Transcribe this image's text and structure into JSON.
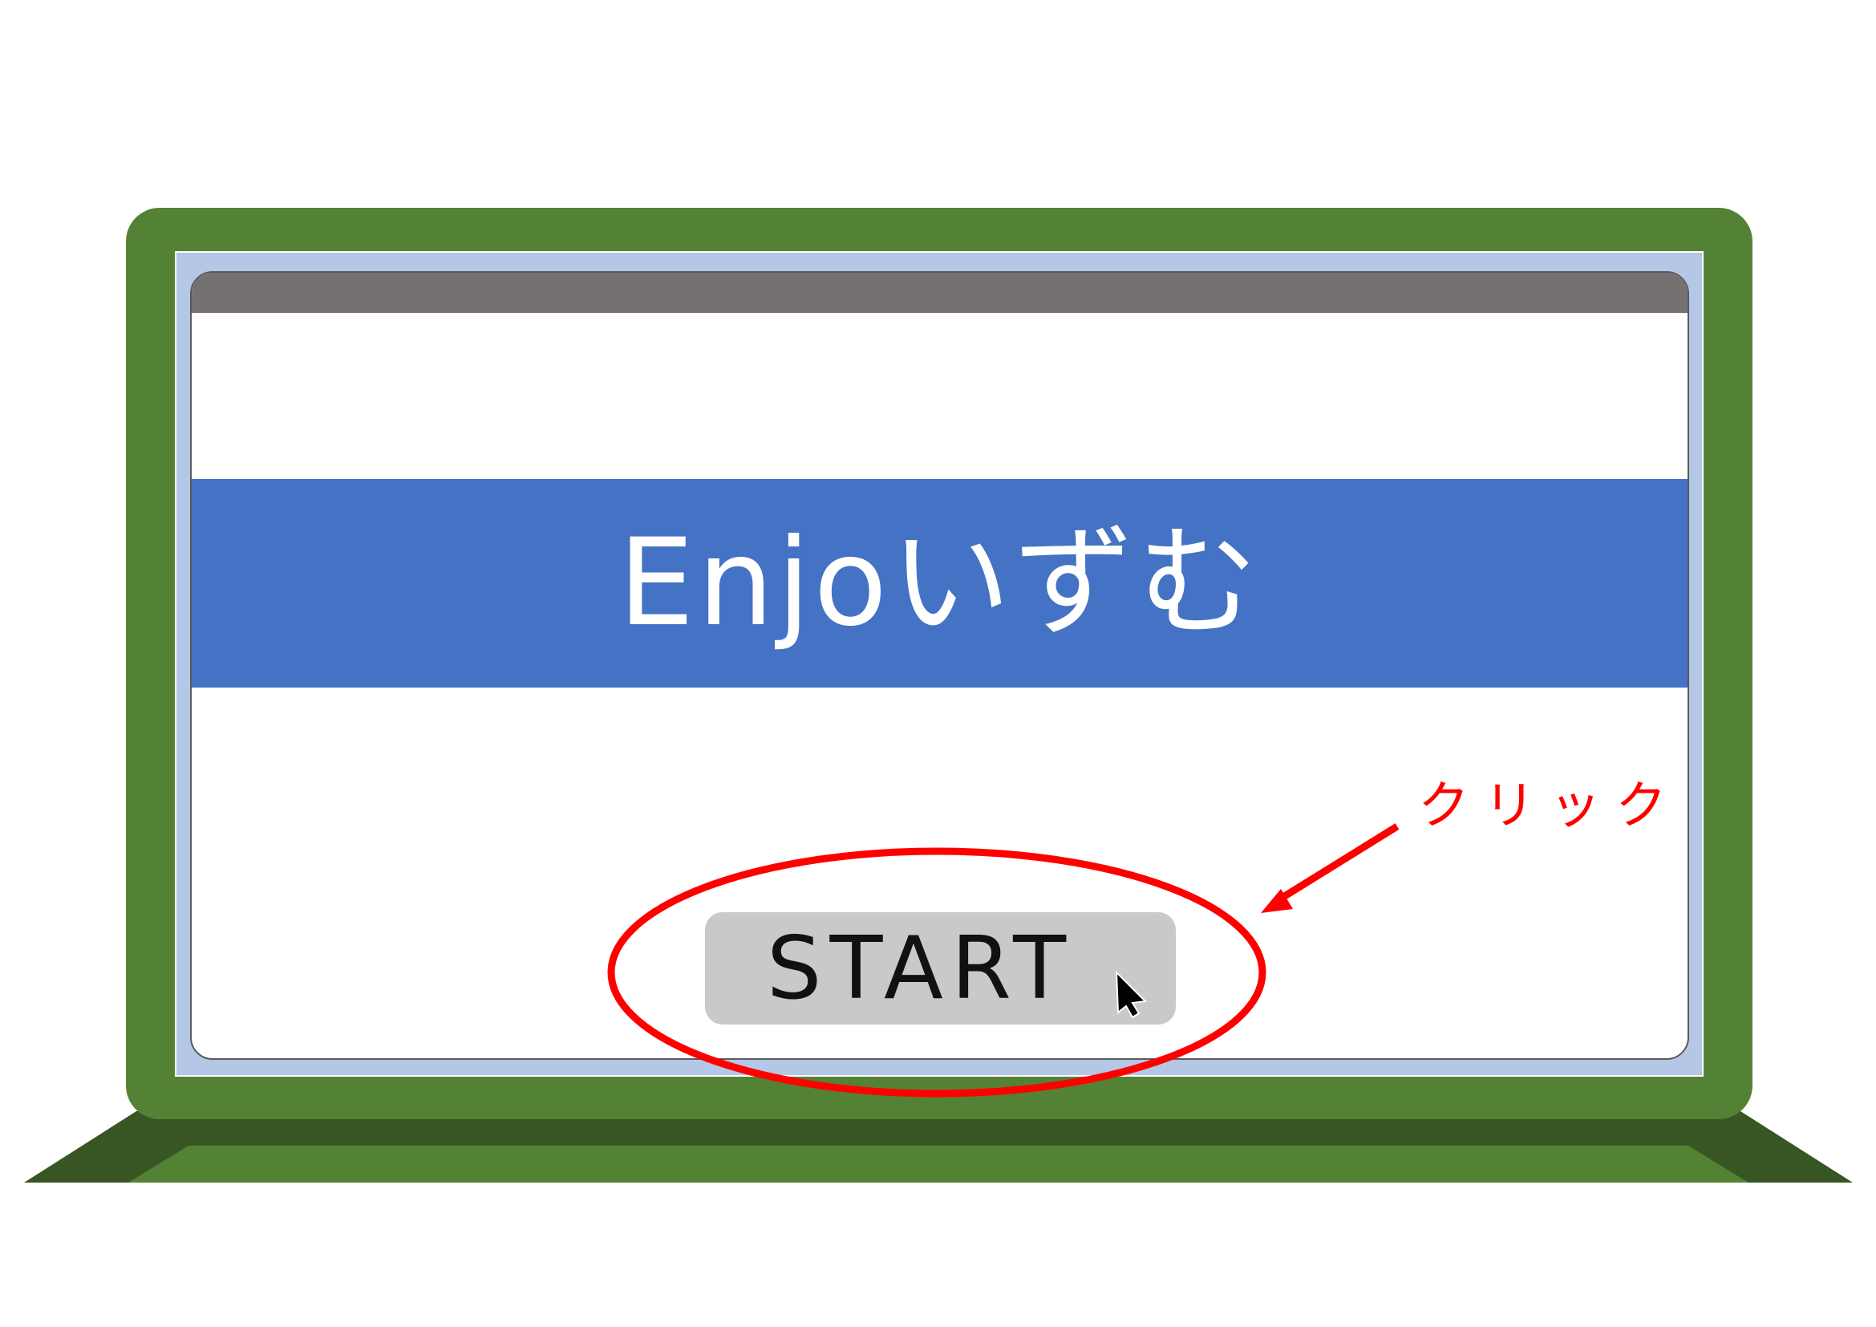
{
  "app": {
    "title_text": "Enjoいずむ",
    "start_label": "START"
  },
  "annotation": {
    "label": "クリック",
    "color": "#ff0000"
  },
  "colors": {
    "laptop_body": "#548235",
    "laptop_base_dark": "#375623",
    "screen_bezel": "#b4c7e7",
    "titlebar": "#767171",
    "banner": "#4472c4",
    "button": "#c9c9c9"
  },
  "icons": {
    "cursor": "mouse-pointer-icon",
    "annotation_arrow": "arrow-icon",
    "highlight": "ellipse-highlight"
  }
}
